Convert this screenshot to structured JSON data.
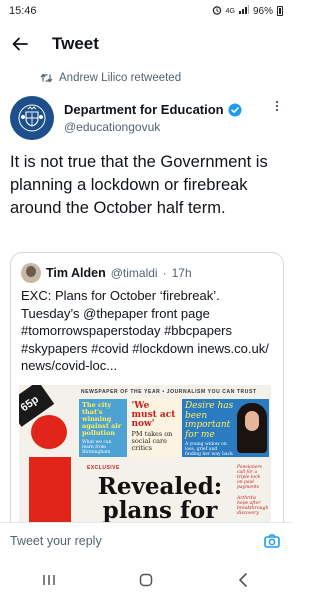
{
  "status_bar": {
    "time": "15:46",
    "alarm_icon": "alarm-icon",
    "network": "4G",
    "battery": "96%"
  },
  "header": {
    "title": "Tweet"
  },
  "retweet": {
    "text": "Andrew Lilico retweeted"
  },
  "tweet": {
    "author_name": "Department for Education",
    "author_handle": "@educationgovuk",
    "text": "It is not true that the Government is planning a lockdown or firebreak around the October half term."
  },
  "quote": {
    "author_name": "Tim Alden",
    "author_handle": "@timaldi",
    "separator": "·",
    "time": "17h",
    "text": "EXC: Plans for October ‘firebreak’. Tuesday’s @thepaper front page #tomorrowspaperstoday #bbcpapers #skypapers #covid #lockdown inews.co.uk/ news/covid-loc...",
    "paper": {
      "price": "65p",
      "top_banner": "NEWSPAPER OF THE YEAR • JOURNALISM YOU CAN TRUST",
      "box1_title": "The city that's winning against air pollution",
      "box1_sub": "What we can learn from Birmingham",
      "box2_big": "'We must act now'",
      "box2_small": "PM takes on social care critics",
      "box3_big": "Desire has been important for me",
      "box3_small": "A young widow on loss, grief and finding her way back",
      "exclusive": "EXCLUSIVE",
      "headline": "Revealed: plans for",
      "side1": "Pensioners call for a triple lock on paid payments",
      "side2": "Arthritis hope after breakthrough discovery"
    }
  },
  "reply": {
    "placeholder": "Tweet your reply"
  },
  "colors": {
    "accent": "#1d9bf0",
    "text": "#0f1419",
    "secondary": "#536471",
    "border": "#cfd9de"
  }
}
